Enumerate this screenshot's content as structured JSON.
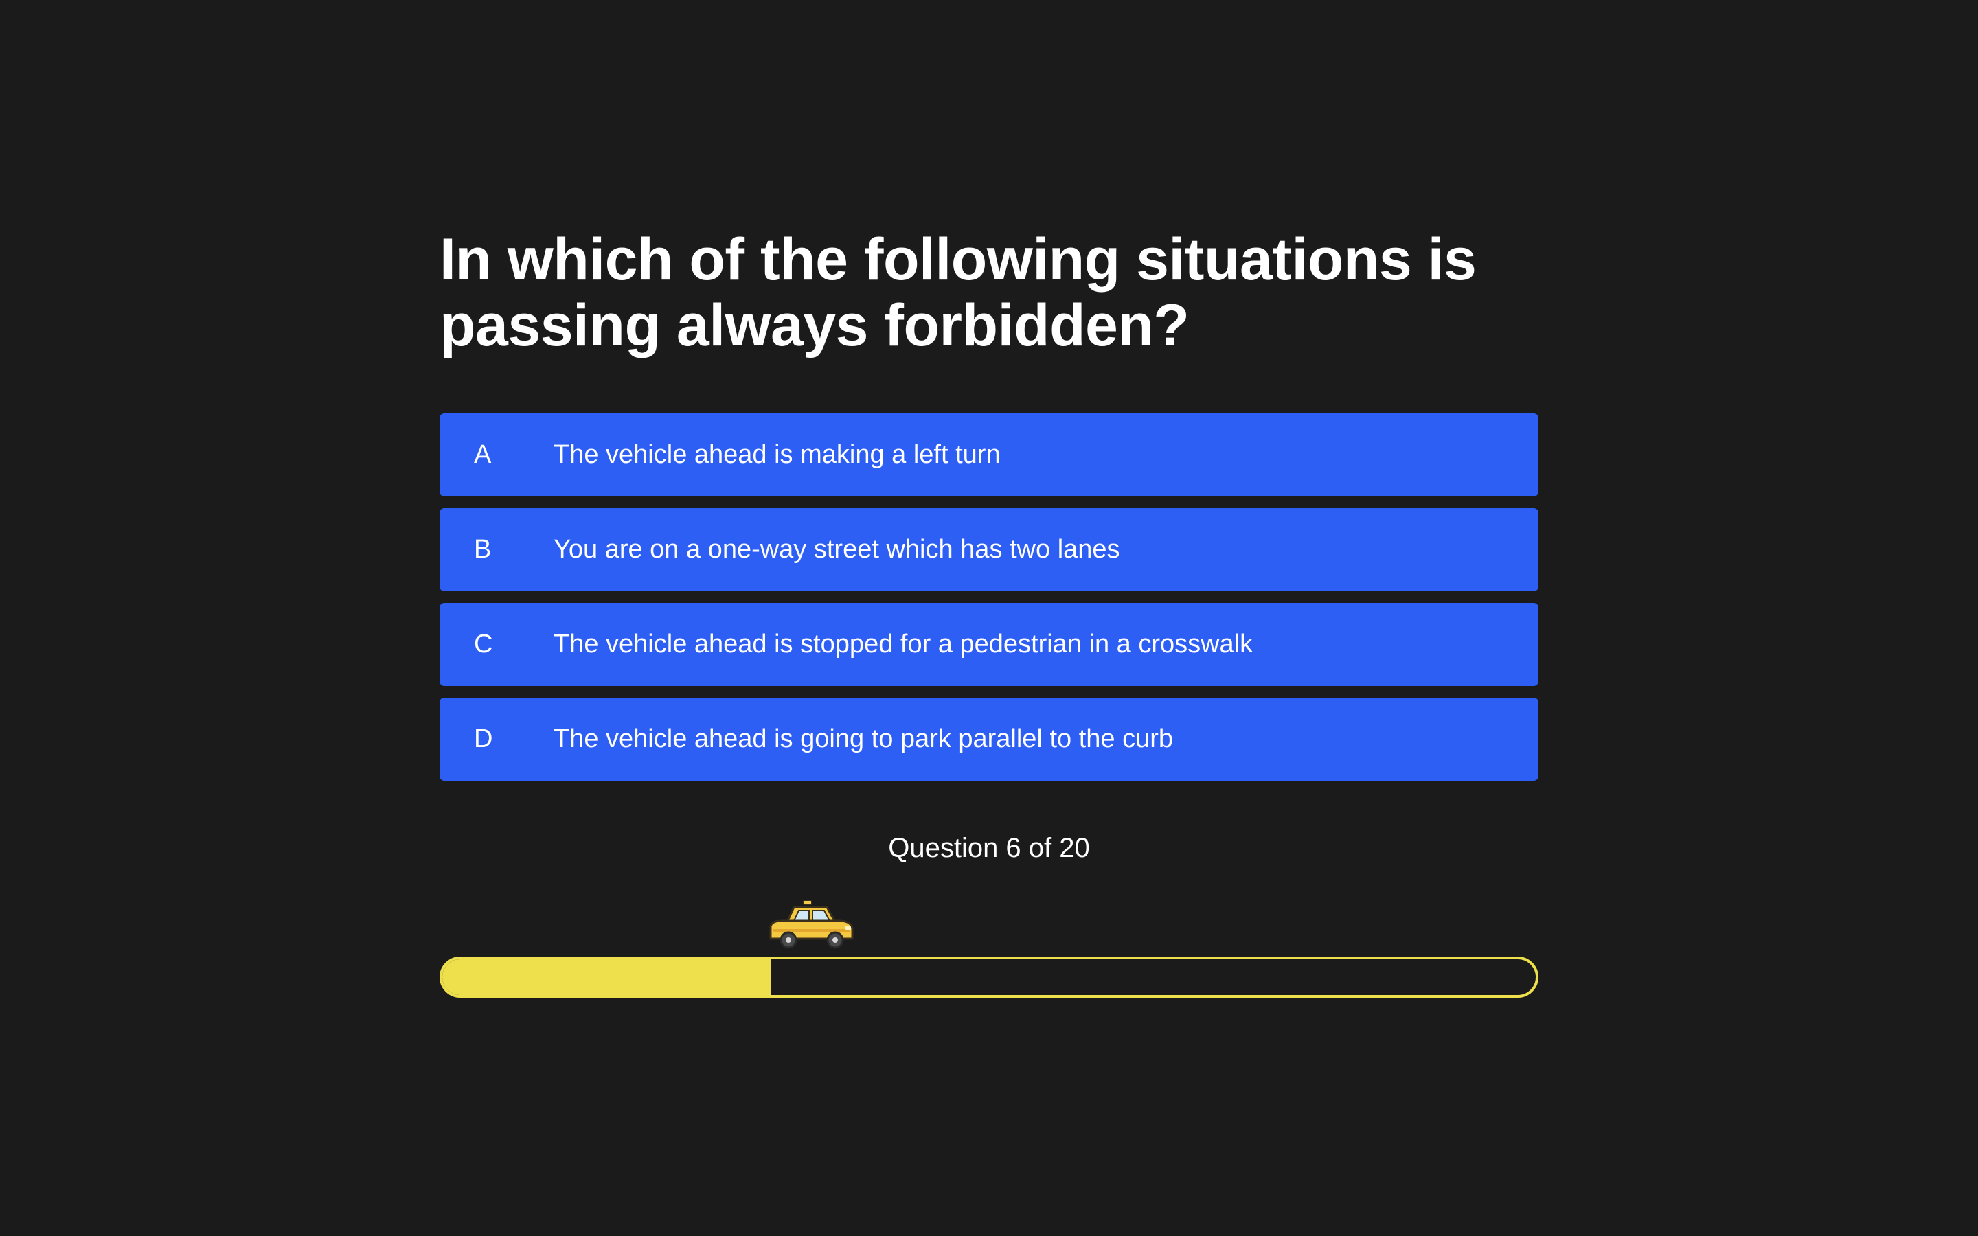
{
  "question": {
    "text": "In which of the following situations is passing always forbidden?"
  },
  "answers": [
    {
      "letter": "A",
      "text": "The vehicle ahead is making a left turn"
    },
    {
      "letter": "B",
      "text": "You are on a one-way street which has two lanes"
    },
    {
      "letter": "C",
      "text": "The vehicle ahead is stopped for a pedestrian in a crosswalk"
    },
    {
      "letter": "D",
      "text": "The vehicle ahead is going to park parallel to the curb"
    }
  ],
  "progress": {
    "label": "Question 6 of 20",
    "fraction": 0.3,
    "marker_icon": "taxi-icon"
  },
  "colors": {
    "background": "#1c1b1c",
    "answer": "#2d5ff5",
    "progress": "#ede04c",
    "text": "#ffffff"
  }
}
